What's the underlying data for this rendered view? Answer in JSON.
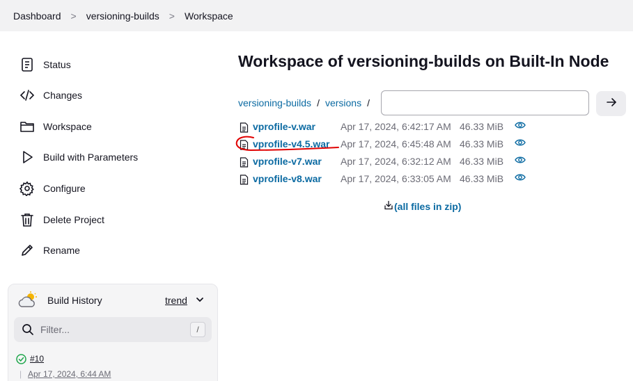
{
  "breadcrumb": {
    "items": [
      "Dashboard",
      "versioning-builds",
      "Workspace"
    ],
    "separator": ">"
  },
  "sidebar": {
    "items": [
      {
        "label": "Status",
        "icon": "document-icon"
      },
      {
        "label": "Changes",
        "icon": "code-icon"
      },
      {
        "label": "Workspace",
        "icon": "folder-icon"
      },
      {
        "label": "Build with Parameters",
        "icon": "play-icon"
      },
      {
        "label": "Configure",
        "icon": "gear-icon"
      },
      {
        "label": "Delete Project",
        "icon": "trash-icon"
      },
      {
        "label": "Rename",
        "icon": "pencil-icon"
      }
    ]
  },
  "build_history": {
    "title": "Build History",
    "trend_label": "trend",
    "filter_placeholder": "Filter...",
    "filter_shortcut": "/",
    "builds": [
      {
        "number": "#10",
        "date": "Apr 17, 2024, 6:44 AM",
        "status": "success"
      }
    ]
  },
  "main": {
    "title": "Workspace of versioning-builds on Built-In Node",
    "path": [
      "versioning-builds",
      "versions"
    ],
    "path_separator": "/",
    "path_input_value": "",
    "files": [
      {
        "name": "vprofile-v.war",
        "date": "Apr 17, 2024, 6:42:17 AM",
        "size": "46.33 MiB"
      },
      {
        "name": "vprofile-v4.5.war",
        "date": "Apr 17, 2024, 6:45:48 AM",
        "size": "46.33 MiB"
      },
      {
        "name": "vprofile-v7.war",
        "date": "Apr 17, 2024, 6:32:12 AM",
        "size": "46.33 MiB"
      },
      {
        "name": "vprofile-v8.war",
        "date": "Apr 17, 2024, 6:33:05 AM",
        "size": "46.33 MiB"
      }
    ],
    "zip_label": "(all files in zip)"
  },
  "colors": {
    "link": "#0b6aa2",
    "annotation": "#e00000",
    "success": "#1ea64b"
  }
}
